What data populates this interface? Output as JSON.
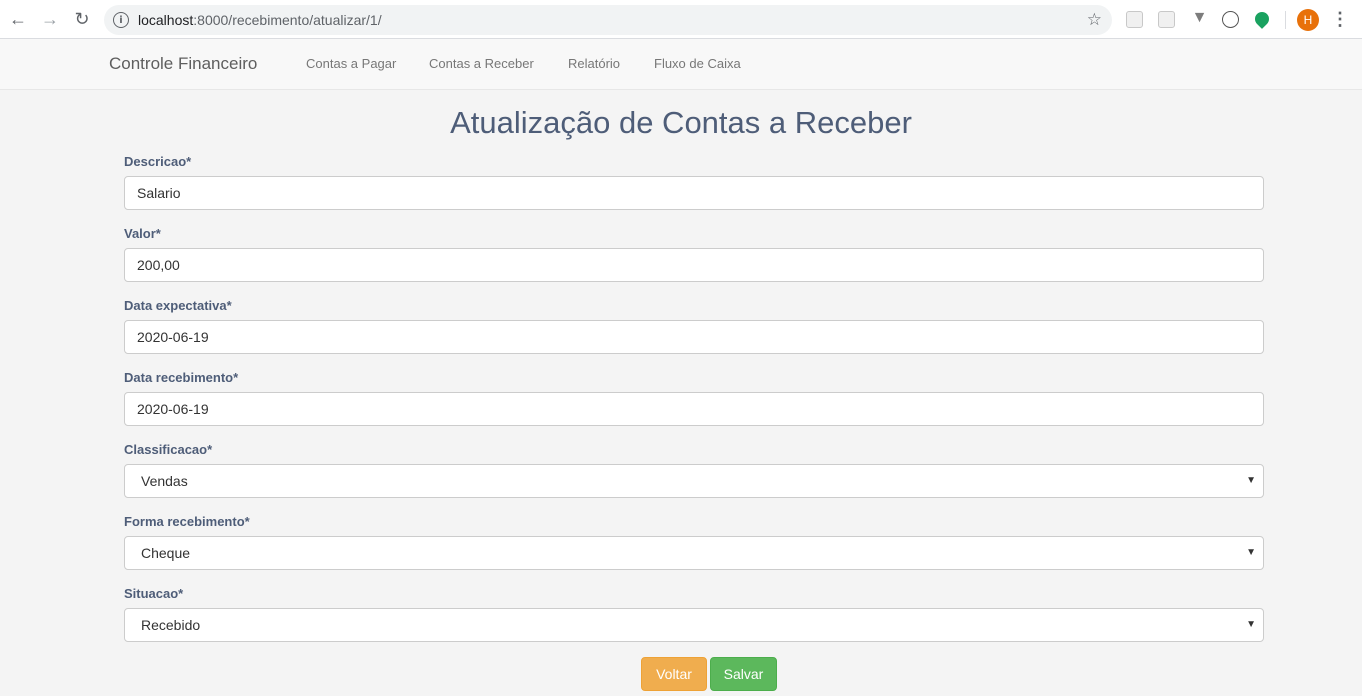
{
  "browser": {
    "url_host": "localhost",
    "url_rest": ":8000/recebimento/atualizar/1/",
    "avatar_letter": "H"
  },
  "navbar": {
    "brand": "Controle Financeiro",
    "links": [
      "Contas a Pagar",
      "Contas a Receber",
      "Relatório",
      "Fluxo de Caixa"
    ]
  },
  "page": {
    "title": "Atualização de Contas a Receber"
  },
  "form": {
    "descricao": {
      "label": "Descricao*",
      "value": "Salario"
    },
    "valor": {
      "label": "Valor*",
      "value": "200,00"
    },
    "data_expectativa": {
      "label": "Data expectativa*",
      "value": "2020-06-19"
    },
    "data_recebimento": {
      "label": "Data recebimento*",
      "value": "2020-06-19"
    },
    "classificacao": {
      "label": "Classificacao*",
      "value": "Vendas"
    },
    "forma_recebimento": {
      "label": "Forma recebimento*",
      "value": "Cheque"
    },
    "situacao": {
      "label": "Situacao*",
      "value": "Recebido"
    }
  },
  "buttons": {
    "voltar": "Voltar",
    "salvar": "Salvar"
  },
  "colors": {
    "voltar": "#f0ad4e",
    "salvar": "#5cb85c",
    "title": "#4e5d78"
  }
}
